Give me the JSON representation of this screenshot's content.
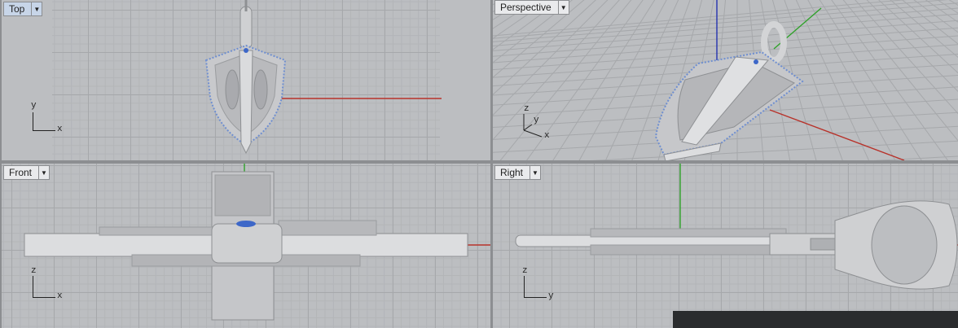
{
  "viewports": {
    "top": {
      "label": "Top",
      "active": true,
      "axis_x": "x",
      "axis_y": "y"
    },
    "perspective": {
      "label": "Perspective",
      "active": false,
      "axis_x": "x",
      "axis_y": "y",
      "axis_z": "z"
    },
    "front": {
      "label": "Front",
      "active": false,
      "axis_x": "x",
      "axis_z": "z"
    },
    "right": {
      "label": "Right",
      "active": false,
      "axis_y": "y",
      "axis_z": "z"
    }
  },
  "dropdown_glyph": "▼",
  "colors": {
    "x_axis": "#b8322a",
    "y_axis": "#2fa22a",
    "z_axis": "#2433b0",
    "model_metal": "#d8d9db",
    "gem": "#3d67c8"
  }
}
